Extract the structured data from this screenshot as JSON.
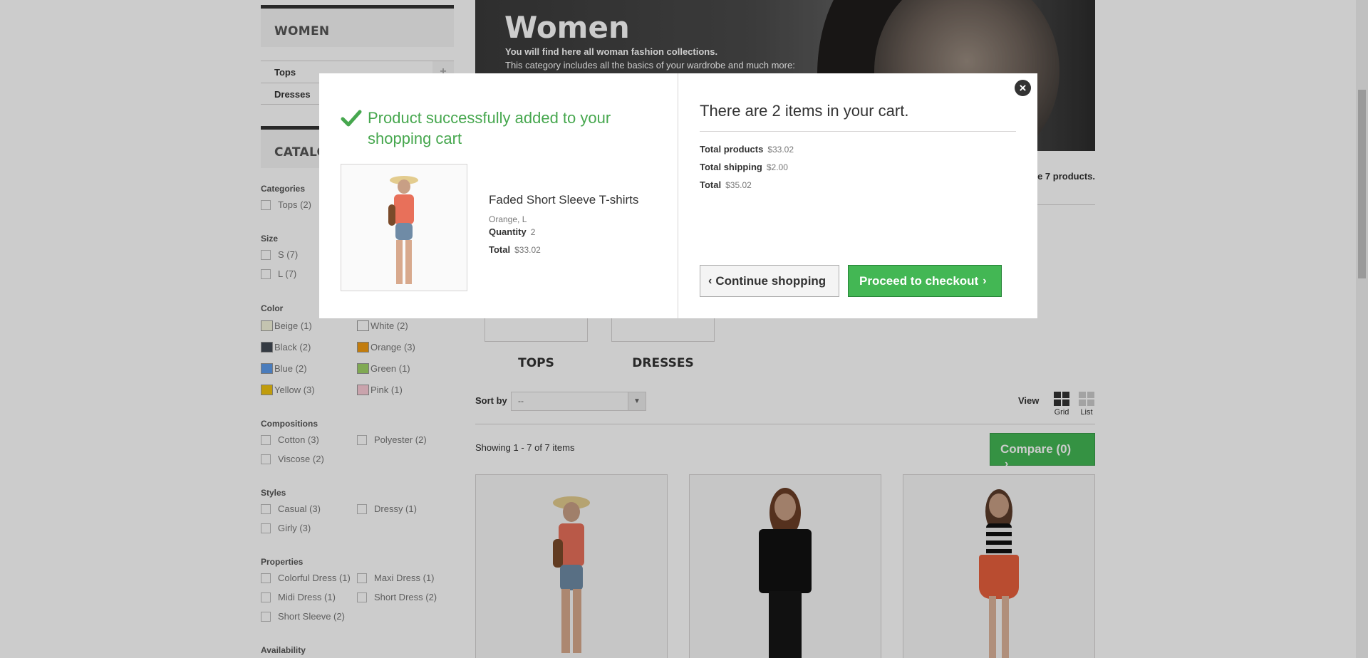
{
  "sidebar": {
    "category_title": "WOMEN",
    "categories": [
      {
        "label": "Tops",
        "expand": "+"
      },
      {
        "label": "Dresses"
      }
    ],
    "catalog_title": "CATALOG",
    "filters": {
      "categories_title": "Categories",
      "categories": [
        "Tops (2)"
      ],
      "size_title": "Size",
      "sizes": [
        "S (7)",
        "L (7)"
      ],
      "color_title": "Color",
      "colors": [
        {
          "label": "Beige (1)",
          "color": "#f5f5dc"
        },
        {
          "label": "White (2)",
          "color": "#ffffff"
        },
        {
          "label": "Black (2)",
          "color": "#434a54"
        },
        {
          "label": "Orange (3)",
          "color": "#f39c11"
        },
        {
          "label": "Blue (2)",
          "color": "#5d9cec"
        },
        {
          "label": "Green (1)",
          "color": "#a0d468"
        },
        {
          "label": "Yellow (3)",
          "color": "#f1c40f"
        },
        {
          "label": "Pink (1)",
          "color": "#fcccd7"
        }
      ],
      "compositions_title": "Compositions",
      "compositions": [
        "Cotton (3)",
        "Polyester (2)",
        "Viscose (2)"
      ],
      "styles_title": "Styles",
      "styles": [
        "Casual (3)",
        "Dressy (1)",
        "Girly (3)"
      ],
      "properties_title": "Properties",
      "properties": [
        "Colorful Dress (1)",
        "Maxi Dress (1)",
        "Midi Dress (1)",
        "Short Dress (2)",
        "Short Sleeve (2)"
      ],
      "availability_title": "Availability"
    }
  },
  "main": {
    "banner_title": "Women",
    "banner_sub1": "You will find here all woman fashion collections.",
    "banner_sub2": "This category includes all the basics of your wardrobe and much more:",
    "products_count": "e 7 products.",
    "subcategories": [
      "TOPS",
      "DRESSES"
    ],
    "sort_label": "Sort by",
    "sort_value": "--",
    "view_label": "View",
    "view_grid": "Grid",
    "view_list": "List",
    "showing": "Showing 1 - 7 of 7 items",
    "compare_label": "Compare (0)"
  },
  "modal": {
    "success_message": "Product successfully added to your shopping cart",
    "product_name": "Faded Short Sleeve T-shirts",
    "product_attributes": "Orange, L",
    "quantity_label": "Quantity",
    "quantity_value": "2",
    "total_label": "Total",
    "total_value": "$33.02",
    "cart_count_text": "There are 2 items in your cart.",
    "total_products_label": "Total products",
    "total_products_value": "$33.02",
    "total_shipping_label": "Total shipping",
    "total_shipping_value": "$2.00",
    "grand_total_label": "Total",
    "grand_total_value": "$35.02",
    "continue_label": "Continue shopping",
    "checkout_label": "Proceed to checkout",
    "close_icon": "close-icon"
  },
  "colors": {
    "success_green": "#46a74e",
    "button_green": "#43b754",
    "overlay": "rgba(0,0,0,0.2)"
  }
}
